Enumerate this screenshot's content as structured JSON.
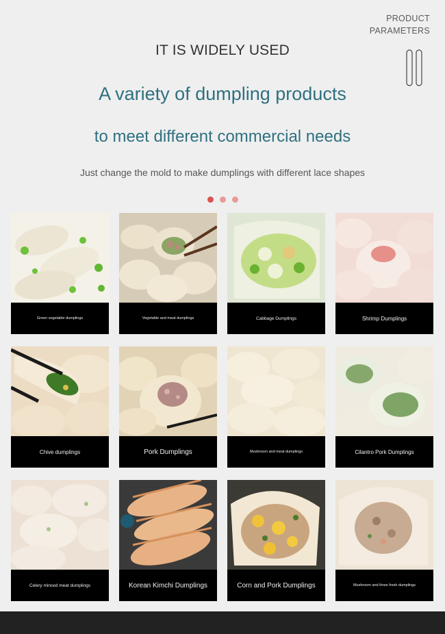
{
  "corner": {
    "line1": "PRODUCT",
    "line2": "PARAMETERS"
  },
  "header": {
    "heading": "IT IS WIDELY USED",
    "headline1": "A variety of dumpling products",
    "headline2": "to meet different commercial needs",
    "subtitle": "Just change the mold to make dumplings with different lace shapes"
  },
  "colors": {
    "accent": "#2f7080",
    "dot_active": "#d9534f",
    "dot_inactive": "#e89a98",
    "caption_bg": "#000000",
    "bottom_bar": "#222222"
  },
  "products": [
    {
      "name": "Green vegetable dumplings",
      "icon": "green-vegetable-dumplings-photo"
    },
    {
      "name": "Vegetable and meat dumplings",
      "icon": "vegetable-meat-dumplings-photo"
    },
    {
      "name": "Cabbage Dumplings",
      "icon": "cabbage-dumplings-photo"
    },
    {
      "name": "Shrimp Dumplings",
      "icon": "shrimp-dumplings-photo"
    },
    {
      "name": "Chive dumplings",
      "icon": "chive-dumplings-photo"
    },
    {
      "name": "Pork Dumplings",
      "icon": "pork-dumplings-photo"
    },
    {
      "name": "Mushroom and meat dumplings",
      "icon": "mushroom-meat-dumplings-photo"
    },
    {
      "name": "Cilantro Pork Dumplings",
      "icon": "cilantro-pork-dumplings-photo"
    },
    {
      "name": "Celery minced meat dumplings",
      "icon": "celery-meat-dumplings-photo"
    },
    {
      "name": "Korean Kimchi Dumplings",
      "icon": "kimchi-dumplings-photo"
    },
    {
      "name": "Corn and Pork Dumplings",
      "icon": "corn-pork-dumplings-photo"
    },
    {
      "name": "Mushroom and three fresh dumplings",
      "icon": "mushroom-three-fresh-dumplings-photo"
    }
  ]
}
